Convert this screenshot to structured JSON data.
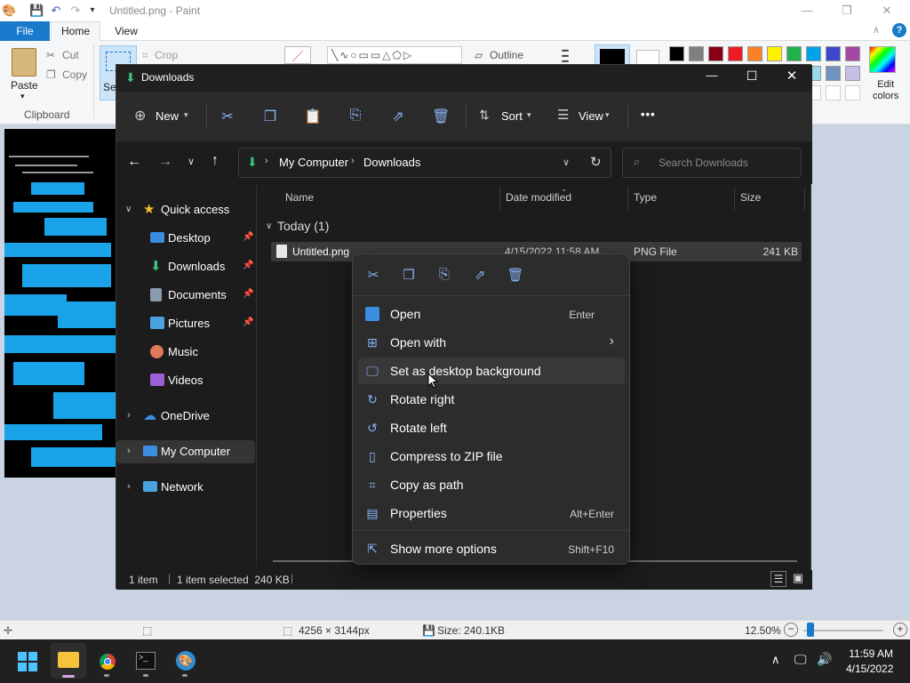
{
  "paint": {
    "title": "Untitled.png - Paint",
    "tabs": {
      "file": "File",
      "home": "Home",
      "view": "View"
    },
    "ribbon": {
      "paste": "Paste",
      "cut": "Cut",
      "copy": "Copy",
      "clipboard": "Clipboard",
      "select": "Se",
      "crop": "Crop",
      "outline": "Outline",
      "edit_colors_1": "Edit",
      "edit_colors_2": "colors"
    },
    "palette": [
      "#000000",
      "#7f7f7f",
      "#880015",
      "#ed1c24",
      "#ff7f27",
      "#fff200",
      "#22b14c",
      "#00a2e8",
      "#3f48cc",
      "#a349a4"
    ],
    "palette_row2": [
      "#ffffff",
      "#c3c3c3",
      "#b97a57",
      "#ffaec9",
      "#ffc90e",
      "#efe4b0",
      "#b5e61d",
      "#99d9ea",
      "#7092be",
      "#c8bfe7"
    ],
    "status": {
      "dimensions": "4256 × 3144px",
      "size": "Size: 240.1KB",
      "zoom": "12.50%"
    }
  },
  "explorer": {
    "title": "Downloads",
    "toolbar": {
      "new": "New",
      "sort": "Sort",
      "view": "View",
      "more": "•••"
    },
    "address": {
      "root": "My Computer",
      "folder": "Downloads"
    },
    "search_placeholder": "Search Downloads",
    "nav": {
      "quick_access": "Quick access",
      "desktop": "Desktop",
      "downloads": "Downloads",
      "documents": "Documents",
      "pictures": "Pictures",
      "music": "Music",
      "videos": "Videos",
      "onedrive": "OneDrive",
      "my_computer": "My Computer",
      "network": "Network"
    },
    "columns": {
      "name": "Name",
      "date": "Date modified",
      "type": "Type",
      "size": "Size"
    },
    "group": "Today (1)",
    "file": {
      "name": "Untitled.png",
      "date": "4/15/2022 11:58 AM",
      "type": "PNG File",
      "size": "241 KB"
    },
    "status": {
      "count": "1 item",
      "selected": "1 item selected  240 KB"
    }
  },
  "context_menu": {
    "items": [
      {
        "label": "Open",
        "accel": "Enter"
      },
      {
        "label": "Open with",
        "accel": "›"
      },
      {
        "label": "Set as desktop background",
        "accel": ""
      },
      {
        "label": "Rotate right",
        "accel": ""
      },
      {
        "label": "Rotate left",
        "accel": ""
      },
      {
        "label": "Compress to ZIP file",
        "accel": ""
      },
      {
        "label": "Copy as path",
        "accel": ""
      },
      {
        "label": "Properties",
        "accel": "Alt+Enter"
      },
      {
        "label": "Show more options",
        "accel": "Shift+F10"
      }
    ]
  },
  "taskbar": {
    "time": "11:59 AM",
    "date": "4/15/2022"
  }
}
